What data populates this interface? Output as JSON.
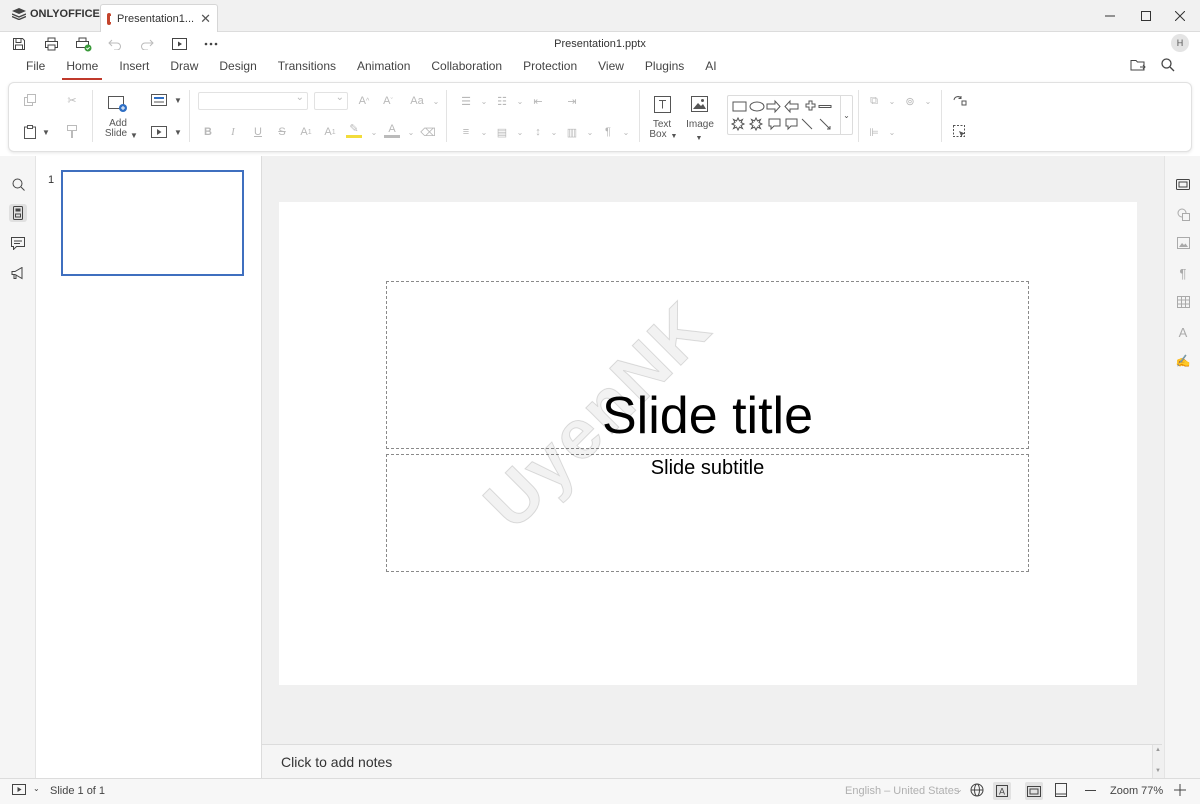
{
  "app": {
    "brand": "ONLYOFFICE",
    "tab_title": "Presentation1...",
    "doc_title": "Presentation1.pptx",
    "avatar_initial": "H"
  },
  "menu": {
    "tabs": [
      "File",
      "Home",
      "Insert",
      "Draw",
      "Design",
      "Transitions",
      "Animation",
      "Collaboration",
      "Protection",
      "View",
      "Plugins",
      "AI"
    ],
    "active": "Home"
  },
  "ribbon": {
    "add_slide_line1": "Add",
    "add_slide_line2": "Slide",
    "text_box_line1": "Text",
    "text_box_line2": "Box",
    "image_label": "Image"
  },
  "thumbnails": {
    "slide_number": "1"
  },
  "slide": {
    "title": "Slide title",
    "subtitle": "Slide subtitle",
    "watermark": "UyenNK"
  },
  "notes": {
    "placeholder": "Click to add notes"
  },
  "status": {
    "slide_counter": "Slide 1 of 1",
    "language": "English – United States",
    "zoom": "Zoom 77%"
  },
  "colors": {
    "accent": "#c0392b",
    "thumb_border": "#3f6fbf"
  }
}
